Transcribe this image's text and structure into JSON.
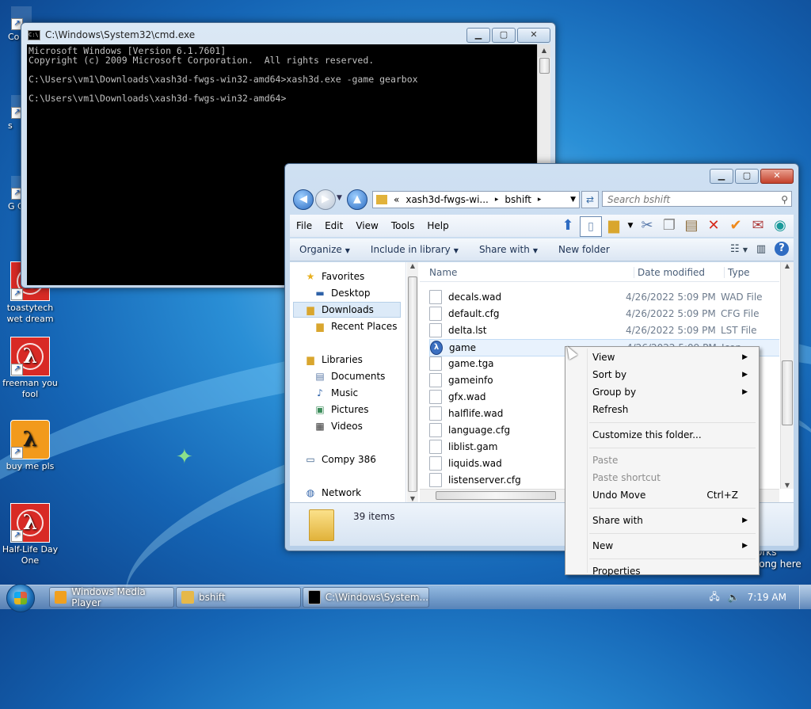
{
  "desktop": {
    "icons": [
      {
        "label": "Co",
        "kind": "partial"
      },
      {
        "label": "s",
        "kind": "partial"
      },
      {
        "label": "G Ch",
        "kind": "partial"
      },
      {
        "label": "toastytech wet dream",
        "kind": "hl-red"
      },
      {
        "label": "freeman you fool",
        "kind": "hl-red"
      },
      {
        "label": "buy me pls",
        "kind": "hl-orange"
      },
      {
        "label": "Half-Life Day One",
        "kind": "hl-red"
      }
    ],
    "right_edge_text": [
      "orks",
      "long here"
    ]
  },
  "cmd": {
    "title": "C:\\Windows\\System32\\cmd.exe",
    "lines": [
      "Microsoft Windows [Version 6.1.7601]",
      "Copyright (c) 2009 Microsoft Corporation.  All rights reserved.",
      "",
      "C:\\Users\\vm1\\Downloads\\xash3d-fwgs-win32-amd64>xash3d.exe -game gearbox",
      "",
      "C:\\Users\\vm1\\Downloads\\xash3d-fwgs-win32-amd64>"
    ]
  },
  "explorer": {
    "address": {
      "chevron": "«",
      "part1": "xash3d-fwgs-wi...",
      "sep": "▸",
      "part2": "bshift",
      "sep2": "▸"
    },
    "search_placeholder": "Search bshift",
    "menu": [
      "File",
      "Edit",
      "View",
      "Tools",
      "Help"
    ],
    "commands": [
      {
        "label": "Organize",
        "dropdown": true
      },
      {
        "label": "Include in library",
        "dropdown": true
      },
      {
        "label": "Share with",
        "dropdown": true
      },
      {
        "label": "New folder",
        "dropdown": false
      }
    ],
    "nav": [
      {
        "label": "Favorites",
        "icon": "star-icon",
        "glyph": "★",
        "color": "#e8b020",
        "indent": false
      },
      {
        "label": "Desktop",
        "icon": "desktop-icon",
        "glyph": "▬",
        "color": "#2f62a8",
        "indent": true
      },
      {
        "label": "Downloads",
        "icon": "downloads-folder-icon",
        "glyph": "▆",
        "color": "#d9a62e",
        "indent": true,
        "selected": true
      },
      {
        "label": "Recent Places",
        "icon": "recent-places-icon",
        "glyph": "▆",
        "color": "#d9a62e",
        "indent": true
      },
      {
        "label": "Libraries",
        "icon": "libraries-icon",
        "glyph": "▆",
        "color": "#d9a62e",
        "indent": false
      },
      {
        "label": "Documents",
        "icon": "documents-icon",
        "glyph": "▤",
        "color": "#5b7aa6",
        "indent": true
      },
      {
        "label": "Music",
        "icon": "music-icon",
        "glyph": "♪",
        "color": "#2f62a8",
        "indent": true
      },
      {
        "label": "Pictures",
        "icon": "pictures-icon",
        "glyph": "▣",
        "color": "#3b8c5a",
        "indent": true
      },
      {
        "label": "Videos",
        "icon": "videos-icon",
        "glyph": "▦",
        "color": "#333333",
        "indent": true
      },
      {
        "label": "Compy 386",
        "icon": "computer-icon",
        "glyph": "▭",
        "color": "#3a5f8a",
        "indent": false
      },
      {
        "label": "Network",
        "icon": "network-icon",
        "glyph": "◍",
        "color": "#2f62a8",
        "indent": false
      }
    ],
    "columns": {
      "name": "Name",
      "date": "Date modified",
      "type": "Type"
    },
    "files": [
      {
        "name": "decals.wad",
        "date": "4/26/2022 5:09 PM",
        "type": "WAD File"
      },
      {
        "name": "default.cfg",
        "date": "4/26/2022 5:09 PM",
        "type": "CFG File"
      },
      {
        "name": "delta.lst",
        "date": "4/26/2022 5:09 PM",
        "type": "LST File"
      },
      {
        "name": "game",
        "date": "4/26/2022 5:09 PM",
        "type": "Icon",
        "halflife": true,
        "selected": true
      },
      {
        "name": "game.tga",
        "date": "",
        "type": "ile"
      },
      {
        "name": "gameinfo",
        "date": "",
        "type": "ocum"
      },
      {
        "name": "gfx.wad",
        "date": "",
        "type": "ile"
      },
      {
        "name": "halflife.wad",
        "date": "",
        "type": "ile"
      },
      {
        "name": "language.cfg",
        "date": "",
        "type": "ile"
      },
      {
        "name": "liblist.gam",
        "date": "",
        "type": "ile"
      },
      {
        "name": "liquids.wad",
        "date": "",
        "type": "ile"
      },
      {
        "name": "listenserver.cfg",
        "date": "",
        "type": "ile"
      }
    ],
    "status": "39 items"
  },
  "context_menu": {
    "items": [
      {
        "label": "View",
        "submenu": true
      },
      {
        "label": "Sort by",
        "submenu": true
      },
      {
        "label": "Group by",
        "submenu": true
      },
      {
        "label": "Refresh"
      },
      {
        "sep": true
      },
      {
        "label": "Customize this folder..."
      },
      {
        "sep": true
      },
      {
        "label": "Paste",
        "disabled": true
      },
      {
        "label": "Paste shortcut",
        "disabled": true
      },
      {
        "label": "Undo Move",
        "shortcut": "Ctrl+Z"
      },
      {
        "sep": true
      },
      {
        "label": "Share with",
        "submenu": true
      },
      {
        "sep": true
      },
      {
        "label": "New",
        "submenu": true
      },
      {
        "sep": true
      },
      {
        "label": "Properties"
      }
    ]
  },
  "taskbar": {
    "buttons": [
      {
        "label": "Windows Media Player",
        "icon": "media-player-icon",
        "color": "#f0a020"
      },
      {
        "label": "bshift",
        "icon": "folder-icon",
        "color": "#e6b84a"
      },
      {
        "label": "C:\\Windows\\System...",
        "icon": "cmd-icon",
        "color": "#000000"
      }
    ],
    "clock": "7:19 AM"
  }
}
